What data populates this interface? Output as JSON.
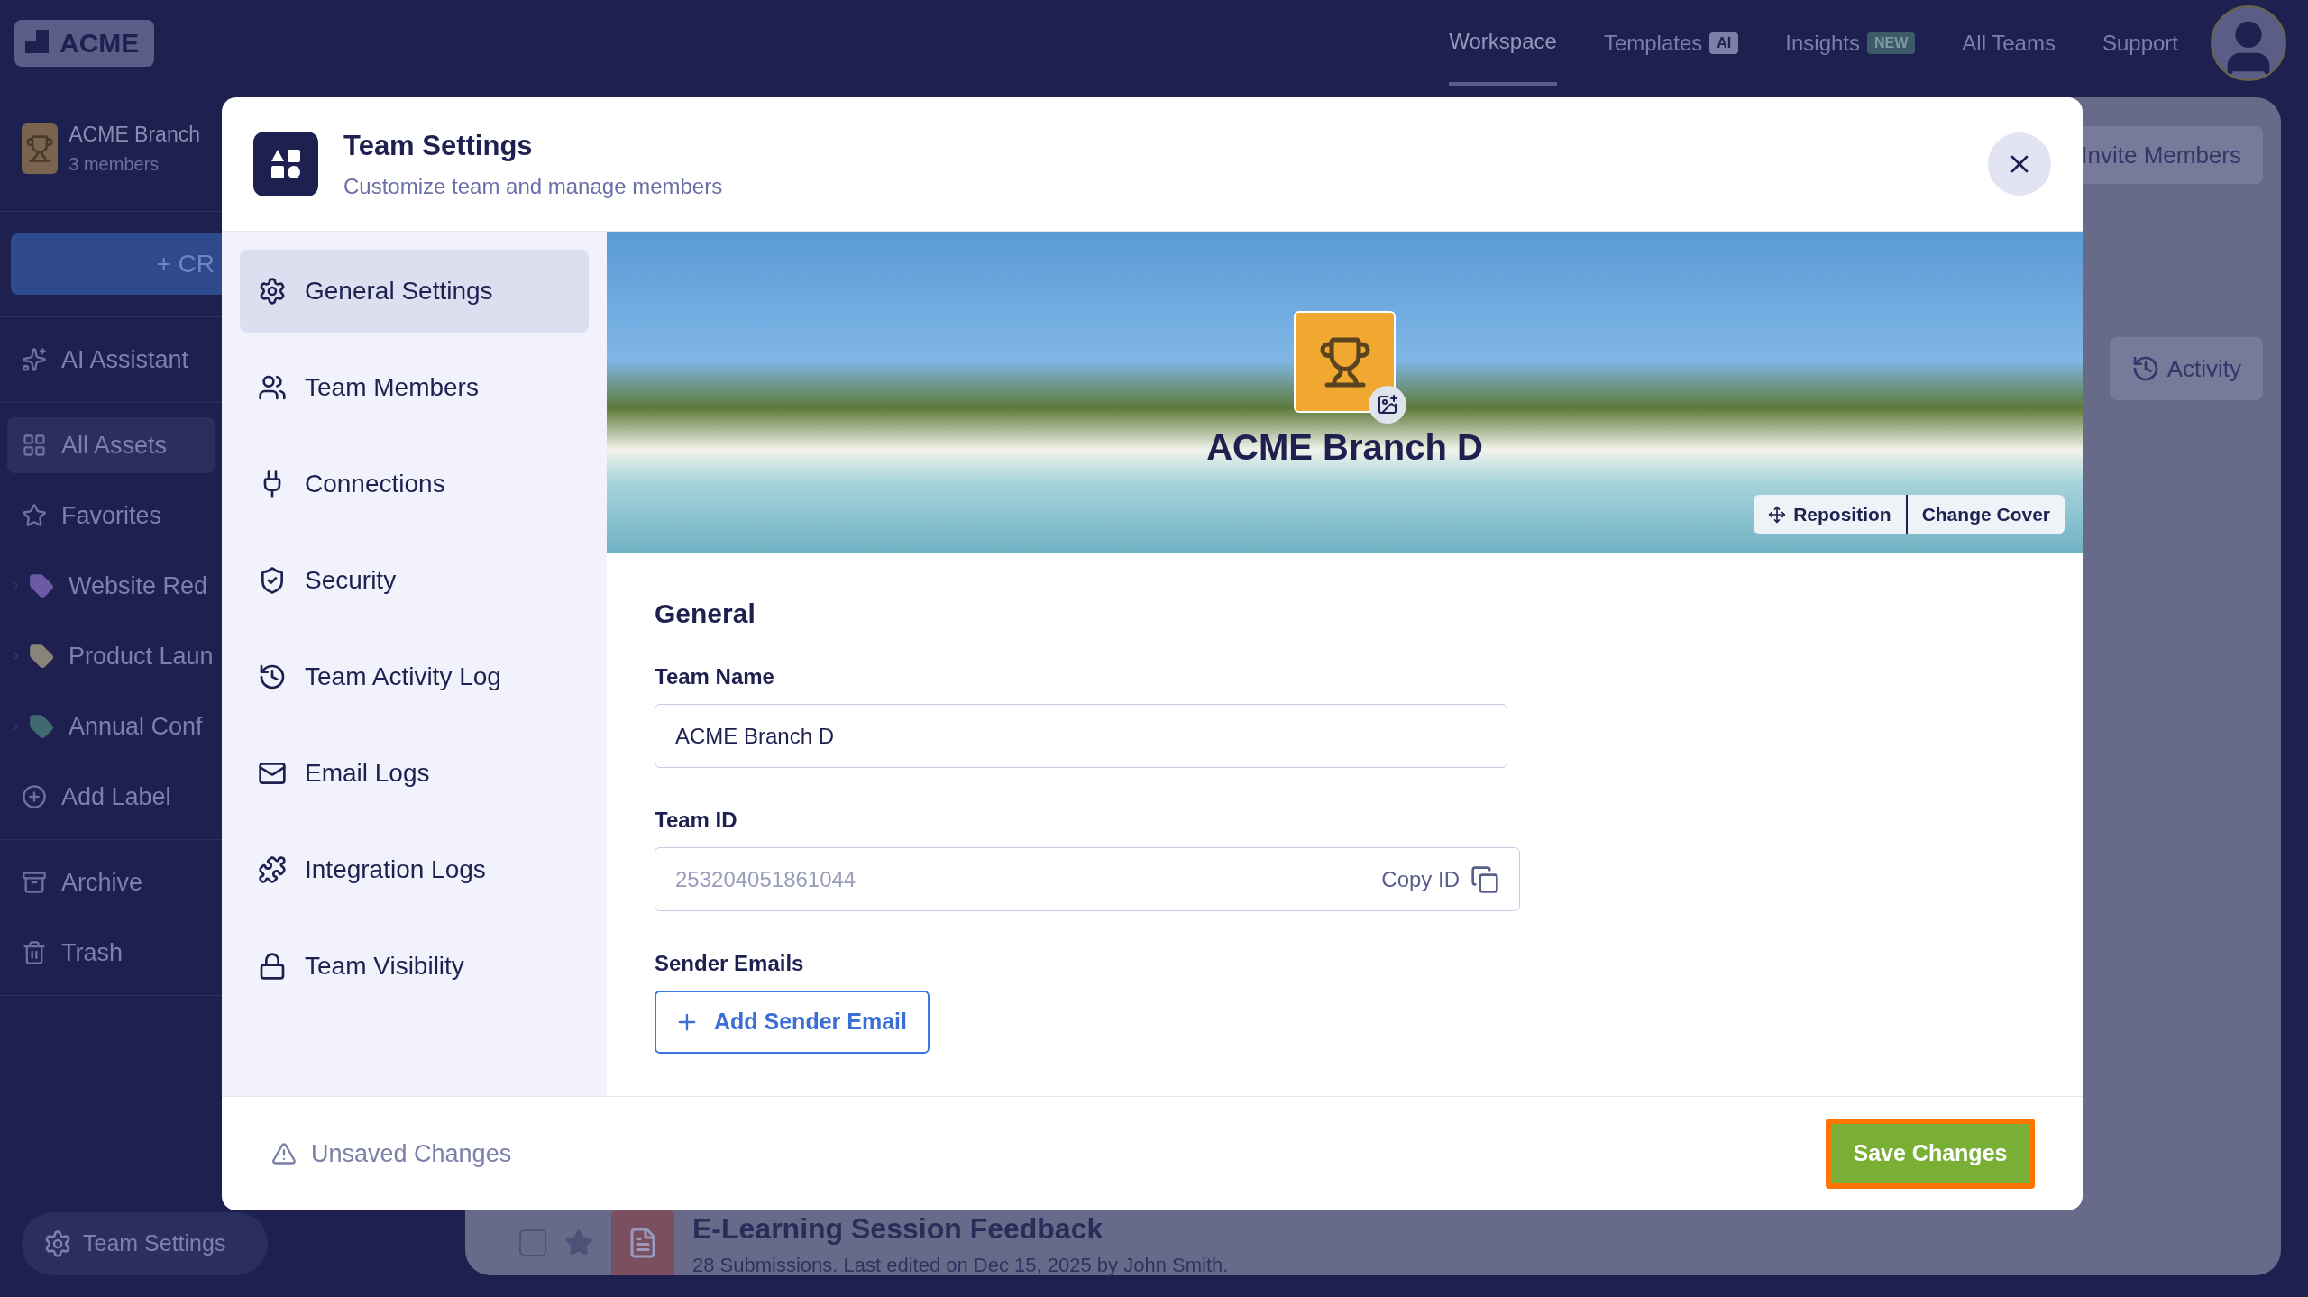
{
  "top_nav": {
    "logo": "ACME",
    "items": [
      {
        "label": "Workspace",
        "selected": true
      },
      {
        "label": "Templates",
        "badge": "AI",
        "selected": false
      },
      {
        "label": "Insights",
        "badge": "NEW",
        "selected": false
      },
      {
        "label": "All Teams",
        "selected": false
      },
      {
        "label": "Support",
        "selected": false
      }
    ]
  },
  "sidebar": {
    "team": {
      "name": "ACME Branch",
      "members": "3 members"
    },
    "create_button": "+ CR",
    "sections": [
      [
        {
          "kind": "nav",
          "label": "AI Assistant",
          "selected": false
        }
      ],
      [
        {
          "kind": "nav",
          "label": "All Assets",
          "selected": true
        },
        {
          "kind": "nav",
          "label": "Favorites",
          "selected": false
        },
        {
          "kind": "label",
          "label": "Website Red",
          "color": "#6a5aa8",
          "selected": false
        },
        {
          "kind": "label",
          "label": "Product Laun",
          "color": "#8a8478",
          "selected": false
        },
        {
          "kind": "label",
          "label": "Annual Conf",
          "color": "#3f6a72",
          "selected": false
        },
        {
          "kind": "add",
          "label": "Add Label",
          "selected": false
        }
      ],
      [
        {
          "kind": "nav",
          "label": "Archive",
          "selected": false
        },
        {
          "kind": "nav",
          "label": "Trash",
          "selected": false
        }
      ]
    ],
    "footer_button": "Team Settings"
  },
  "background": {
    "invite_button": "Invite Members",
    "activity_button": "Activity",
    "row": {
      "checked": false,
      "title": "E-Learning Session Feedback",
      "subtitle": "28 Submissions. Last edited on Dec 15, 2025 by John Smith."
    }
  },
  "modal": {
    "title": "Team Settings",
    "subtitle": "Customize team and manage members",
    "nav": [
      {
        "label": "General Settings",
        "selected": true
      },
      {
        "label": "Team Members",
        "selected": false
      },
      {
        "label": "Connections",
        "selected": false
      },
      {
        "label": "Security",
        "selected": false
      },
      {
        "label": "Team Activity Log",
        "selected": false
      },
      {
        "label": "Email Logs",
        "selected": false
      },
      {
        "label": "Integration Logs",
        "selected": false
      },
      {
        "label": "Team Visibility",
        "selected": false
      }
    ],
    "cover": {
      "team_name": "ACME Branch D",
      "reposition_button": "Reposition",
      "change_cover_button": "Change Cover"
    },
    "section_title": "General",
    "team_name": {
      "label": "Team Name",
      "value": "ACME Branch D"
    },
    "team_id": {
      "label": "Team ID",
      "value": "253204051861044",
      "disabled": true,
      "copy_button": "Copy ID"
    },
    "sender_emails": {
      "label": "Sender Emails",
      "button": "Add Sender Email"
    },
    "footer": {
      "status": "Unsaved Changes",
      "save_button": "Save Changes"
    }
  }
}
